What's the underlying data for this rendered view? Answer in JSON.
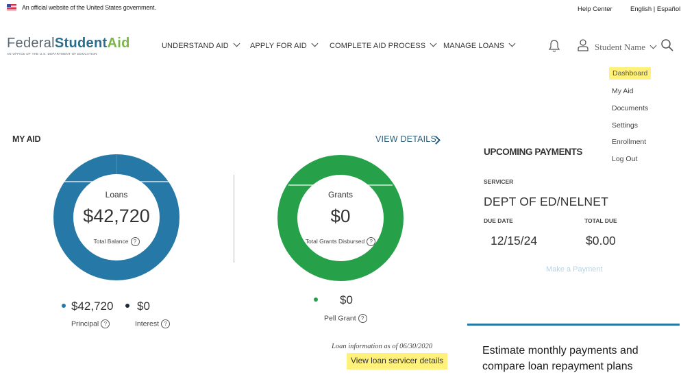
{
  "gov_banner": {
    "text": "An official website of the United States government.",
    "help_center": "Help Center",
    "language": "English | Español"
  },
  "logo": {
    "part1": "Federal",
    "part2": "Student",
    "part3": "Aid",
    "subtitle": "An office of the U.S. Department of Education"
  },
  "nav": [
    {
      "label": "UNDERSTAND AID"
    },
    {
      "label": "APPLY FOR AID"
    },
    {
      "label": "COMPLETE AID PROCESS"
    },
    {
      "label": "MANAGE LOANS"
    }
  ],
  "user": {
    "name": "Student Name"
  },
  "dropdown": [
    "Dashboard",
    "My Aid",
    "Documents",
    "Settings",
    "Enrollment",
    "Log Out"
  ],
  "my_aid": {
    "title": "MY AID",
    "view_details": "VIEW DETAILS",
    "loans": {
      "label": "Loans",
      "value": "$42,720",
      "sub": "Total Balance",
      "principal_amount": "$42,720",
      "principal_label": "Principal",
      "interest_amount": "$0",
      "interest_label": "Interest"
    },
    "grants": {
      "label": "Grants",
      "value": "$0",
      "sub": "Total Grants Disbursed",
      "pell_amount": "$0",
      "pell_label": "Pell Grant"
    },
    "loan_info": "Loan information as of 06/30/2020",
    "servicer_link": "View loan servicer details"
  },
  "upcoming": {
    "title": "UPCOMING PAYMENTS",
    "servicer_label": "SERVICER",
    "servicer_value": "DEPT OF ED/NELNET",
    "due_label": "DUE DATE",
    "due_value": "12/15/24",
    "total_label": "TOTAL DUE",
    "total_value": "$0.00",
    "pay_button": "Make a Payment"
  },
  "estimate_text": "Estimate monthly payments and compare loan repayment plans",
  "colors": {
    "loans": "#2679a6",
    "grants": "#27a149",
    "highlight": "#fff17a",
    "interest": "#1b2a3a"
  }
}
